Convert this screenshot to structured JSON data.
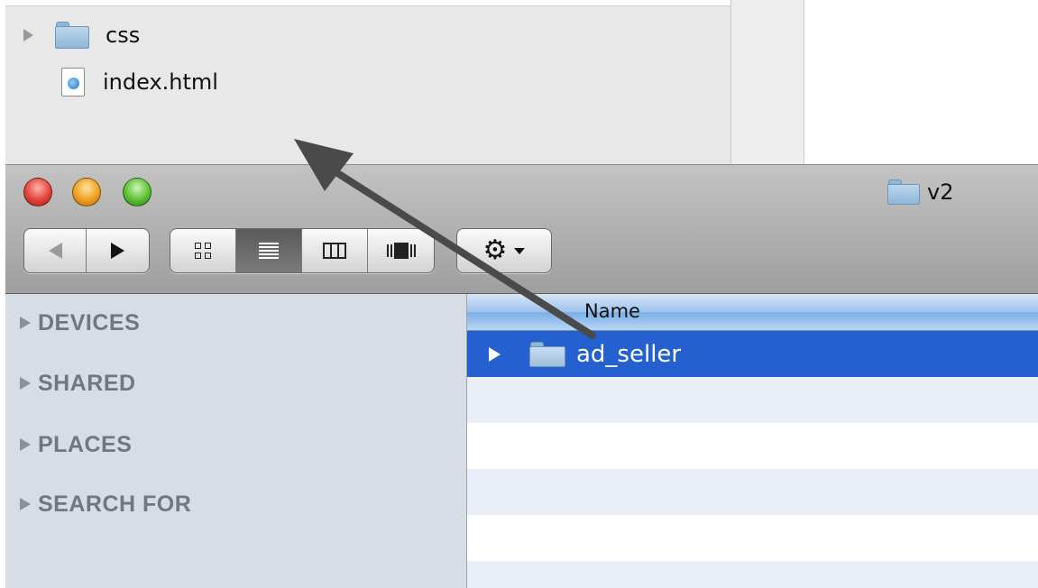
{
  "background_finder": {
    "items": [
      {
        "name": "css",
        "kind": "folder",
        "expandable": true
      },
      {
        "name": "index.html",
        "kind": "html-file",
        "expandable": false
      }
    ]
  },
  "window": {
    "title": "v2",
    "toolbar": {
      "nav": {
        "back_icon": "back-arrow-icon",
        "forward_icon": "forward-arrow-icon"
      },
      "views": [
        {
          "icon": "icon-view-icon",
          "active": false
        },
        {
          "icon": "list-view-icon",
          "active": true
        },
        {
          "icon": "column-view-icon",
          "active": false
        },
        {
          "icon": "coverflow-view-icon",
          "active": false
        }
      ],
      "action_icon": "gear-icon"
    }
  },
  "sidebar": {
    "sections": [
      {
        "label": "DEVICES"
      },
      {
        "label": "SHARED"
      },
      {
        "label": "PLACES"
      },
      {
        "label": "SEARCH FOR"
      }
    ]
  },
  "list": {
    "column_header": "Name",
    "rows": [
      {
        "name": "ad_seller",
        "kind": "folder",
        "selected": true
      }
    ]
  },
  "colors": {
    "selection": "#2460d0",
    "sidebar": "#d6dde5",
    "alt_row": "#e8eff9",
    "arrow": "#4a4a4a"
  }
}
